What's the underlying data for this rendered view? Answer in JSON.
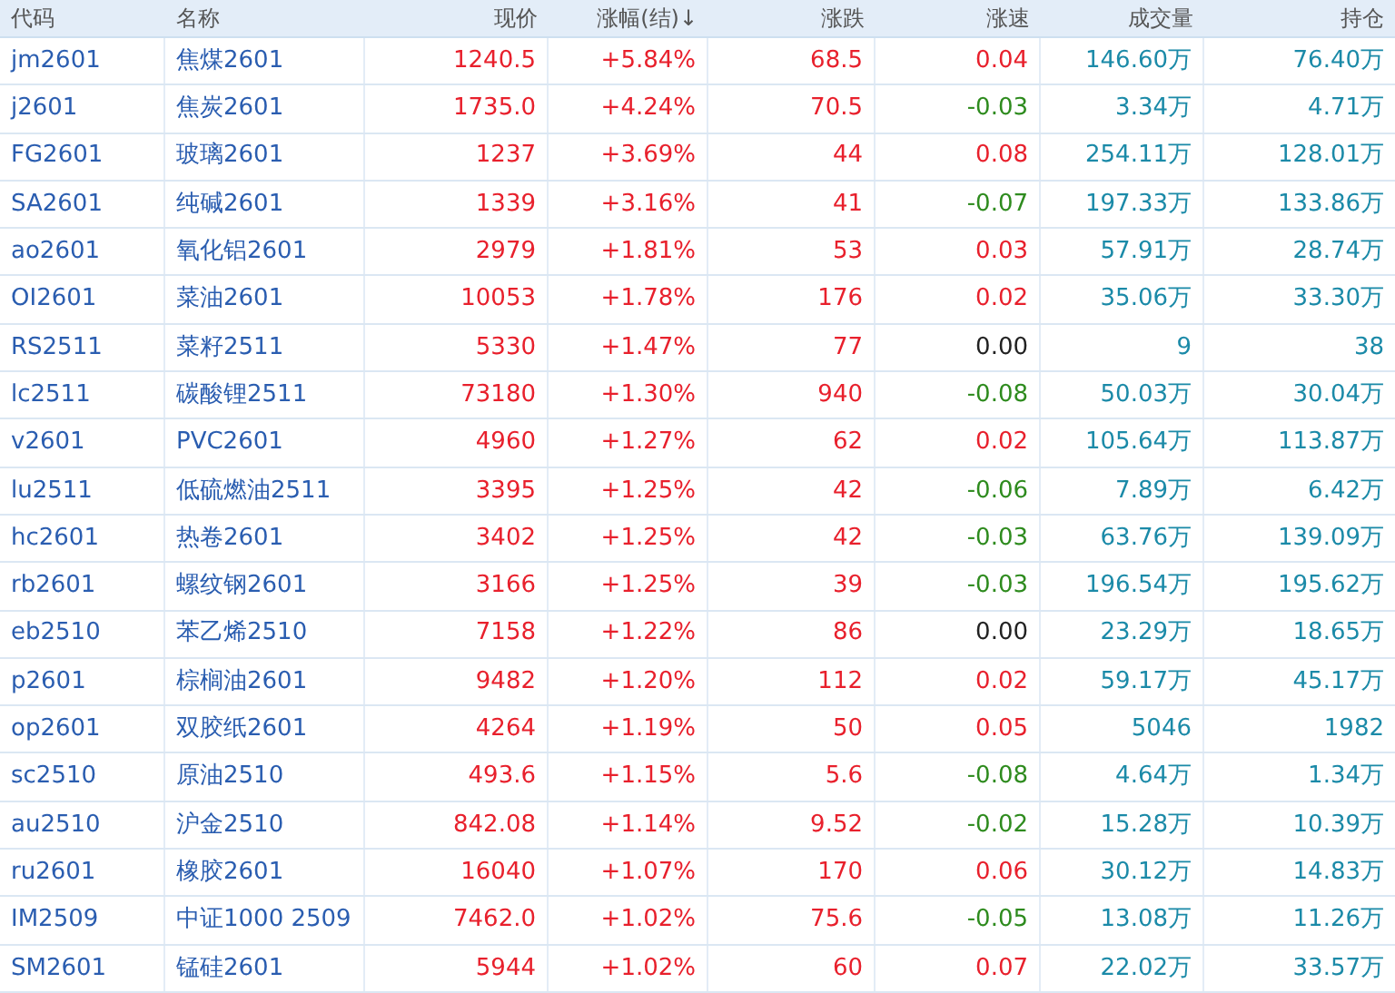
{
  "columns": [
    "代码",
    "名称",
    "现价",
    "涨幅(结)↓",
    "涨跌",
    "涨速",
    "成交量",
    "持仓"
  ],
  "rows": [
    {
      "code": "jm2601",
      "name": "焦煤2601",
      "price": "1240.5",
      "pct": "+5.84%",
      "change": "68.5",
      "speed": "0.04",
      "speed_up": true,
      "speed_down": false,
      "volume": "146.60万",
      "open_interest": "76.40万"
    },
    {
      "code": "j2601",
      "name": "焦炭2601",
      "price": "1735.0",
      "pct": "+4.24%",
      "change": "70.5",
      "speed": "-0.03",
      "speed_up": false,
      "speed_down": true,
      "volume": "3.34万",
      "open_interest": "4.71万"
    },
    {
      "code": "FG2601",
      "name": "玻璃2601",
      "price": "1237",
      "pct": "+3.69%",
      "change": "44",
      "speed": "0.08",
      "speed_up": true,
      "speed_down": false,
      "volume": "254.11万",
      "open_interest": "128.01万"
    },
    {
      "code": "SA2601",
      "name": "纯碱2601",
      "price": "1339",
      "pct": "+3.16%",
      "change": "41",
      "speed": "-0.07",
      "speed_up": false,
      "speed_down": true,
      "volume": "197.33万",
      "open_interest": "133.86万"
    },
    {
      "code": "ao2601",
      "name": "氧化铝2601",
      "price": "2979",
      "pct": "+1.81%",
      "change": "53",
      "speed": "0.03",
      "speed_up": true,
      "speed_down": false,
      "volume": "57.91万",
      "open_interest": "28.74万"
    },
    {
      "code": "OI2601",
      "name": "菜油2601",
      "price": "10053",
      "pct": "+1.78%",
      "change": "176",
      "speed": "0.02",
      "speed_up": true,
      "speed_down": false,
      "volume": "35.06万",
      "open_interest": "33.30万"
    },
    {
      "code": "RS2511",
      "name": "菜籽2511",
      "price": "5330",
      "pct": "+1.47%",
      "change": "77",
      "speed": "0.00",
      "speed_up": false,
      "speed_down": false,
      "volume": "9",
      "open_interest": "38"
    },
    {
      "code": "lc2511",
      "name": "碳酸锂2511",
      "price": "73180",
      "pct": "+1.30%",
      "change": "940",
      "speed": "-0.08",
      "speed_up": false,
      "speed_down": true,
      "volume": "50.03万",
      "open_interest": "30.04万"
    },
    {
      "code": "v2601",
      "name": "PVC2601",
      "price": "4960",
      "pct": "+1.27%",
      "change": "62",
      "speed": "0.02",
      "speed_up": true,
      "speed_down": false,
      "volume": "105.64万",
      "open_interest": "113.87万"
    },
    {
      "code": "lu2511",
      "name": "低硫燃油2511",
      "price": "3395",
      "pct": "+1.25%",
      "change": "42",
      "speed": "-0.06",
      "speed_up": false,
      "speed_down": true,
      "volume": "7.89万",
      "open_interest": "6.42万"
    },
    {
      "code": "hc2601",
      "name": "热卷2601",
      "price": "3402",
      "pct": "+1.25%",
      "change": "42",
      "speed": "-0.03",
      "speed_up": false,
      "speed_down": true,
      "volume": "63.76万",
      "open_interest": "139.09万"
    },
    {
      "code": "rb2601",
      "name": "螺纹钢2601",
      "price": "3166",
      "pct": "+1.25%",
      "change": "39",
      "speed": "-0.03",
      "speed_up": false,
      "speed_down": true,
      "volume": "196.54万",
      "open_interest": "195.62万"
    },
    {
      "code": "eb2510",
      "name": "苯乙烯2510",
      "price": "7158",
      "pct": "+1.22%",
      "change": "86",
      "speed": "0.00",
      "speed_up": false,
      "speed_down": false,
      "volume": "23.29万",
      "open_interest": "18.65万"
    },
    {
      "code": "p2601",
      "name": "棕榈油2601",
      "price": "9482",
      "pct": "+1.20%",
      "change": "112",
      "speed": "0.02",
      "speed_up": true,
      "speed_down": false,
      "volume": "59.17万",
      "open_interest": "45.17万"
    },
    {
      "code": "op2601",
      "name": "双胶纸2601",
      "price": "4264",
      "pct": "+1.19%",
      "change": "50",
      "speed": "0.05",
      "speed_up": true,
      "speed_down": false,
      "volume": "5046",
      "open_interest": "1982"
    },
    {
      "code": "sc2510",
      "name": "原油2510",
      "price": "493.6",
      "pct": "+1.15%",
      "change": "5.6",
      "speed": "-0.08",
      "speed_up": false,
      "speed_down": true,
      "volume": "4.64万",
      "open_interest": "1.34万"
    },
    {
      "code": "au2510",
      "name": "沪金2510",
      "price": "842.08",
      "pct": "+1.14%",
      "change": "9.52",
      "speed": "-0.02",
      "speed_up": false,
      "speed_down": true,
      "volume": "15.28万",
      "open_interest": "10.39万"
    },
    {
      "code": "ru2601",
      "name": "橡胶2601",
      "price": "16040",
      "pct": "+1.07%",
      "change": "170",
      "speed": "0.06",
      "speed_up": true,
      "speed_down": false,
      "volume": "30.12万",
      "open_interest": "14.83万"
    },
    {
      "code": "IM2509",
      "name": "中证1000 2509",
      "price": "7462.0",
      "pct": "+1.02%",
      "change": "75.6",
      "speed": "-0.05",
      "speed_up": false,
      "speed_down": true,
      "volume": "13.08万",
      "open_interest": "11.26万"
    },
    {
      "code": "SM2601",
      "name": "锰硅2601",
      "price": "5944",
      "pct": "+1.02%",
      "change": "60",
      "speed": "0.07",
      "speed_up": true,
      "speed_down": false,
      "volume": "22.02万",
      "open_interest": "33.57万"
    }
  ]
}
